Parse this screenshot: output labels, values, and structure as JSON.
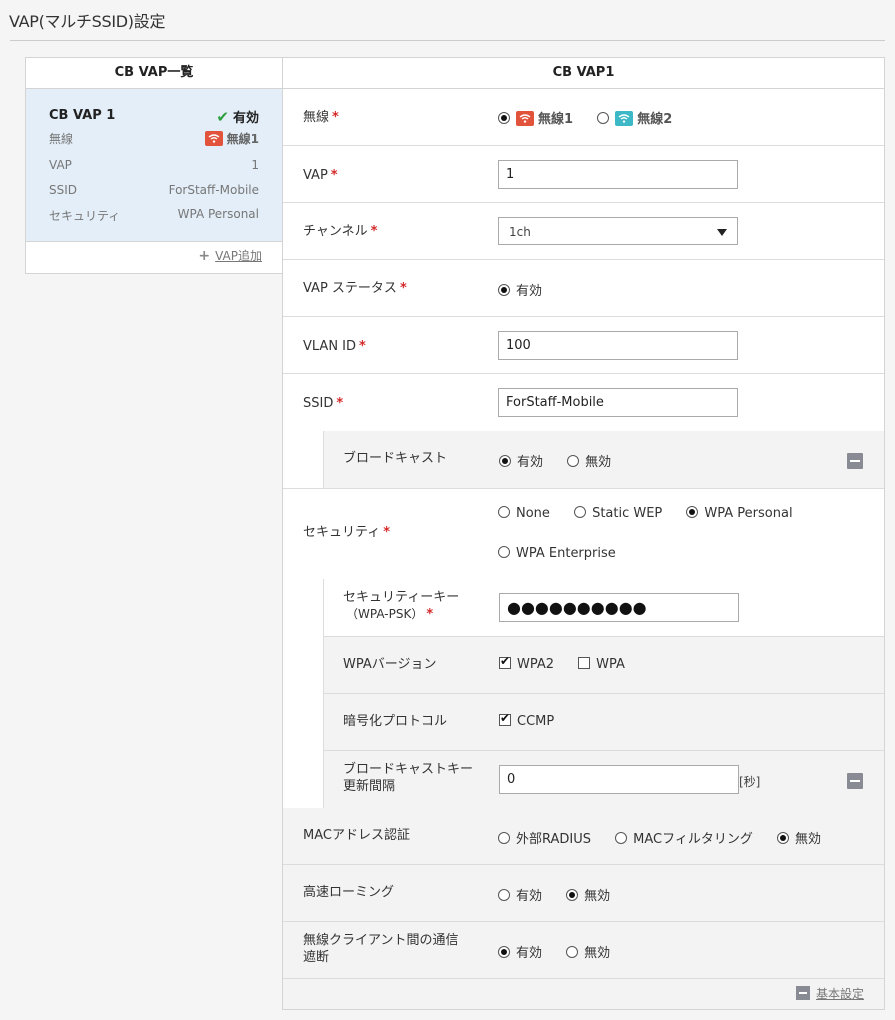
{
  "page": {
    "title": "VAP(マルチSSID)設定"
  },
  "left": {
    "heading": "CB VAP一覧",
    "card": {
      "name": "CB VAP 1",
      "status": "有効",
      "rows": [
        {
          "label": "無線",
          "value": "無線1"
        },
        {
          "label": "VAP",
          "value": "1"
        },
        {
          "label": "SSID",
          "value": "ForStaff-Mobile"
        },
        {
          "label": "セキュリティ",
          "value": "WPA Personal"
        }
      ]
    },
    "add_label": "VAP追加"
  },
  "right": {
    "heading": "CB VAP1",
    "radio_field": {
      "label": "無線",
      "options": [
        "無線1",
        "無線2"
      ],
      "selected": "無線1"
    },
    "vap": {
      "label": "VAP",
      "value": "1"
    },
    "channel": {
      "label": "チャンネル",
      "value": "1ch"
    },
    "vap_status": {
      "label": "VAP ステータス",
      "option": "有効"
    },
    "vlan": {
      "label": "VLAN ID",
      "value": "100"
    },
    "ssid": {
      "label": "SSID",
      "value": "ForStaff-Mobile"
    },
    "broadcast": {
      "label": "ブロードキャスト",
      "options": [
        "有効",
        "無効"
      ],
      "selected": "有効"
    },
    "security": {
      "label": "セキュリティ",
      "options": [
        "None",
        "Static WEP",
        "WPA Personal",
        "WPA Enterprise"
      ],
      "selected": "WPA Personal"
    },
    "security_key": {
      "label_line1": "セキュリティーキー",
      "label_line2": "（WPA-PSK）",
      "value": "●●●●●●●●●●"
    },
    "wpa_version": {
      "label": "WPAバージョン",
      "options": [
        "WPA2",
        "WPA"
      ],
      "checked": [
        "WPA2"
      ]
    },
    "encryption": {
      "label": "暗号化プロトコル",
      "options": [
        "CCMP"
      ],
      "checked": [
        "CCMP"
      ]
    },
    "rekey": {
      "label_line1": "ブロードキャストキー",
      "label_line2": "更新間隔",
      "value": "0",
      "unit": "[秒]"
    },
    "mac_auth": {
      "label": "MACアドレス認証",
      "options": [
        "外部RADIUS",
        "MACフィルタリング",
        "無効"
      ],
      "selected": "無効"
    },
    "fast_roaming": {
      "label": "高速ローミング",
      "options": [
        "有効",
        "無効"
      ],
      "selected": "無効"
    },
    "client_isolation": {
      "label_line1": "無線クライアント間の通信",
      "label_line2": "遮断",
      "options": [
        "有効",
        "無効"
      ],
      "selected": "有効"
    },
    "basic_settings_label": "基本設定"
  },
  "colors": {
    "required": "#d42a2a",
    "active_check": "#2e9e3f",
    "wifi1": "#e2533b",
    "wifi2": "#3cb8c6",
    "card_bg": "#e3eef8"
  },
  "icons": [
    "wifi-icon",
    "check-icon",
    "plus-icon",
    "collapse-icon",
    "chevron-down-icon"
  ]
}
